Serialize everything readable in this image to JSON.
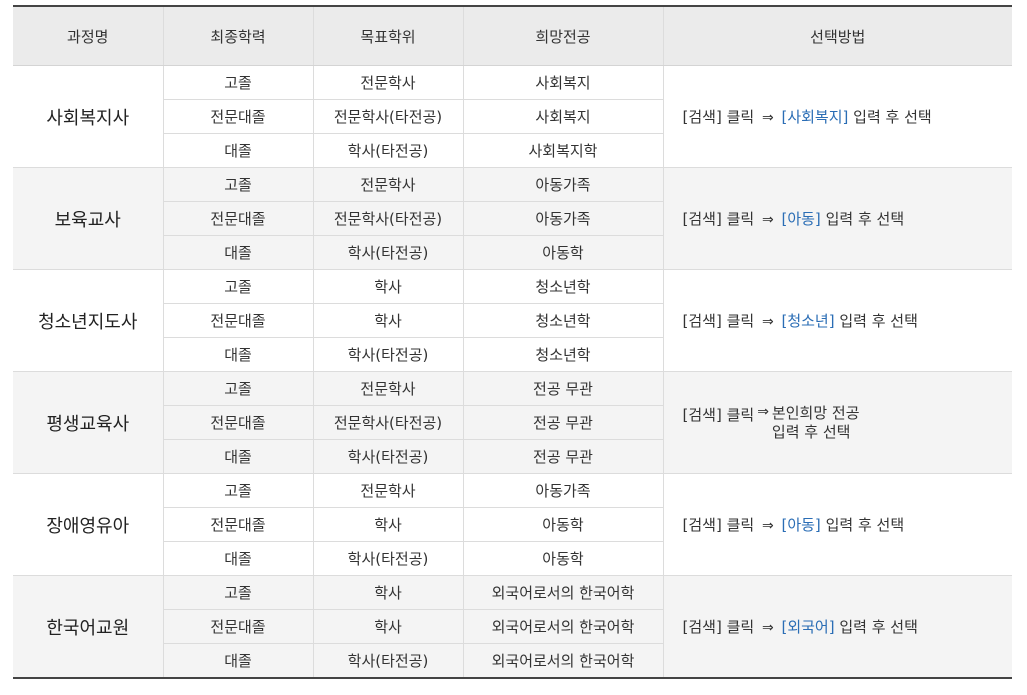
{
  "headers": [
    "과정명",
    "최종학력",
    "목표학위",
    "희망전공",
    "선택방법"
  ],
  "groups": [
    {
      "course": "사회복지사",
      "rows": [
        {
          "edu": "고졸",
          "degree": "전문학사",
          "major": "사회복지"
        },
        {
          "edu": "전문대졸",
          "degree": "전문학사(타전공)",
          "major": "사회복지"
        },
        {
          "edu": "대졸",
          "degree": "학사(타전공)",
          "major": "사회복지학"
        }
      ],
      "method": {
        "pre": "[검색] 클릭",
        "arrow": "⇒",
        "keyword": "[사회복지]",
        "post": "입력 후 선택"
      }
    },
    {
      "course": "보육교사",
      "rows": [
        {
          "edu": "고졸",
          "degree": "전문학사",
          "major": "아동가족"
        },
        {
          "edu": "전문대졸",
          "degree": "전문학사(타전공)",
          "major": "아동가족"
        },
        {
          "edu": "대졸",
          "degree": "학사(타전공)",
          "major": "아동학"
        }
      ],
      "method": {
        "pre": "[검색] 클릭",
        "arrow": "⇒",
        "keyword": "[아동]",
        "post": "입력 후 선택"
      }
    },
    {
      "course": "청소년지도사",
      "rows": [
        {
          "edu": "고졸",
          "degree": "학사",
          "major": "청소년학"
        },
        {
          "edu": "전문대졸",
          "degree": "학사",
          "major": "청소년학"
        },
        {
          "edu": "대졸",
          "degree": "학사(타전공)",
          "major": "청소년학"
        }
      ],
      "method": {
        "pre": "[검색] 클릭",
        "arrow": "⇒",
        "keyword": "[청소년]",
        "post": "입력 후 선택"
      }
    },
    {
      "course": "평생교육사",
      "rows": [
        {
          "edu": "고졸",
          "degree": "전문학사",
          "major": "전공 무관"
        },
        {
          "edu": "전문대졸",
          "degree": "전문학사(타전공)",
          "major": "전공 무관"
        },
        {
          "edu": "대졸",
          "degree": "학사(타전공)",
          "major": "전공 무관"
        }
      ],
      "method": {
        "pre": "[검색] 클릭",
        "arrow": "⇒",
        "line1": "본인희망 전공",
        "line2": "입력 후 선택"
      }
    },
    {
      "course": "장애영유아",
      "rows": [
        {
          "edu": "고졸",
          "degree": "전문학사",
          "major": "아동가족"
        },
        {
          "edu": "전문대졸",
          "degree": "학사",
          "major": "아동학"
        },
        {
          "edu": "대졸",
          "degree": "학사(타전공)",
          "major": "아동학"
        }
      ],
      "method": {
        "pre": "[검색] 클릭",
        "arrow": "⇒",
        "keyword": "[아동]",
        "post": "입력 후 선택"
      }
    },
    {
      "course": "한국어교원",
      "rows": [
        {
          "edu": "고졸",
          "degree": "학사",
          "major": "외국어로서의 한국어학"
        },
        {
          "edu": "전문대졸",
          "degree": "학사",
          "major": "외국어로서의 한국어학"
        },
        {
          "edu": "대졸",
          "degree": "학사(타전공)",
          "major": "외국어로서의 한국어학"
        }
      ],
      "method": {
        "pre": "[검색] 클릭",
        "arrow": "⇒",
        "keyword": "[외국어]",
        "post": "입력 후 선택"
      }
    }
  ]
}
